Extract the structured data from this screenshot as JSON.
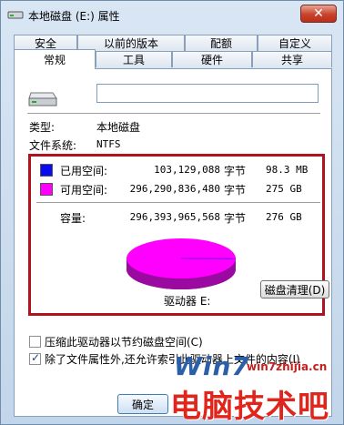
{
  "window": {
    "title": "本地磁盘 (E:) 属性",
    "close_label": "✕"
  },
  "tabs": {
    "row1": [
      "安全",
      "以前的版本",
      "配额",
      "自定义"
    ],
    "row2": [
      "常规",
      "工具",
      "硬件",
      "共享"
    ],
    "active": "常规"
  },
  "general": {
    "name_value": "",
    "type_label": "类型:",
    "type_value": "本地磁盘",
    "fs_label": "文件系统:",
    "fs_value": "NTFS",
    "used": {
      "label": "已用空间:",
      "bytes": "103,129,088",
      "unit": "字节",
      "size": "98.3 MB",
      "color": "#0b0bf0"
    },
    "free": {
      "label": "可用空间:",
      "bytes": "296,290,836,480",
      "unit": "字节",
      "size": "275 GB",
      "color": "#ff00ff"
    },
    "capacity": {
      "label": "容量:",
      "bytes": "296,393,965,568",
      "unit": "字节",
      "size": "276 GB"
    },
    "drive_label": "驱动器 E:",
    "cleanup_label": "磁盘清理(D)",
    "compress_label": "压缩此驱动器以节约磁盘空间(C)",
    "compress_checked": false,
    "index_label": "除了文件属性外,还允许索引此驱动器上文件的内容(I)",
    "index_checked": true,
    "pie_used_fraction": 0.0003
  },
  "footer": {
    "ok_label": "确定"
  },
  "watermark": {
    "logo": "Win7",
    "url": "win7zhijia.cn",
    "cn": "电脑技术吧"
  }
}
